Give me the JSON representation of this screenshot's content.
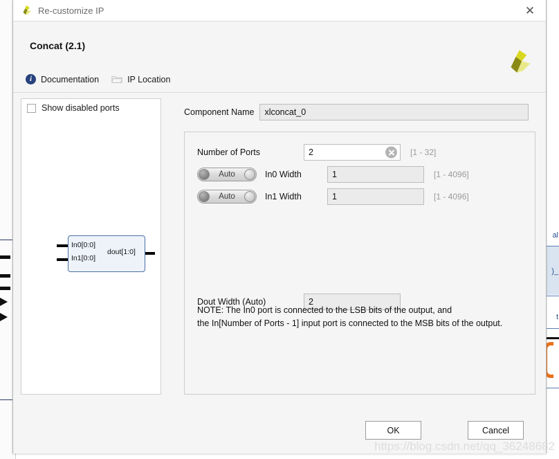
{
  "window": {
    "title": "Re-customize IP",
    "app_icon": "xilinx-logo-icon",
    "close_label": "✕"
  },
  "header": {
    "ip_title": "Concat (2.1)",
    "brand_logo": "xilinx-logo",
    "links": [
      {
        "icon": "info-icon",
        "label": "Documentation"
      },
      {
        "icon": "folder-icon",
        "label": "IP Location"
      }
    ]
  },
  "preview": {
    "show_disabled_ports": {
      "label": "Show disabled ports",
      "checked": false
    },
    "symbol": {
      "in0_label": "In0[0:0]",
      "in1_label": "In1[0:0]",
      "out_label": "dout[1:0]"
    }
  },
  "form": {
    "component_name": {
      "label": "Component Name",
      "value": "xlconcat_0"
    },
    "number_of_ports": {
      "label": "Number of Ports",
      "value": "2",
      "range": "[1 - 32]",
      "clear_icon": "clear-circle-x-icon"
    },
    "port_widths": [
      {
        "toggle_label": "Auto",
        "label": "In0 Width",
        "value": "1",
        "range": "[1 - 4096]"
      },
      {
        "toggle_label": "Auto",
        "label": "In1 Width",
        "value": "1",
        "range": "[1 - 4096]"
      }
    ],
    "dout_width": {
      "label": "Dout Width (Auto)",
      "value": "2"
    },
    "note_line1": "NOTE: The In0 port is connected to the LSB bits of the output, and",
    "note_line2": "the In[Number of Ports - 1] input port is connected to the MSB bits of the output."
  },
  "footer": {
    "ok_label": "OK",
    "cancel_label": "Cancel"
  },
  "watermark": "https://blog.csdn.net/qq_36248682",
  "colors": {
    "dialog_bg": "#f5f5f5",
    "panel_bg": "#ffffff",
    "symbol_fill": "#eef3fa",
    "symbol_border": "#4a6fa5",
    "brand_yellow": "#d9d820",
    "brand_olive": "#8a8a16",
    "info_blue": "#27427d",
    "hint_gray": "#9a9a9a"
  }
}
